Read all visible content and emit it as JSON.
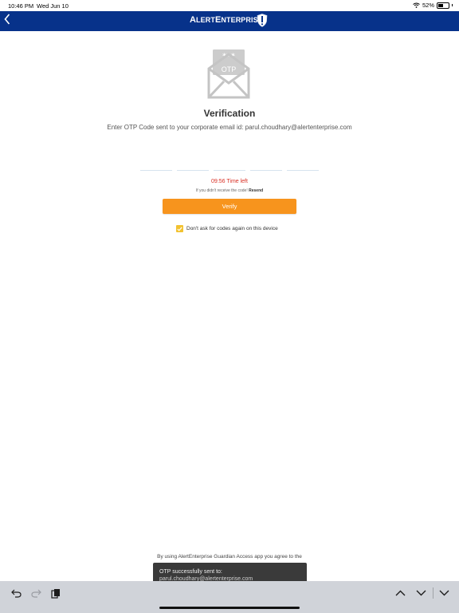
{
  "status_bar": {
    "time": "10:46 PM",
    "date": "Wed Jun 10",
    "battery": "52%"
  },
  "nav": {
    "back_icon": "chevron-left-icon",
    "brand_prefix_big": "A",
    "brand_prefix_small": "LERT",
    "brand_suffix_big": "E",
    "brand_suffix_small": "NTERPRISE",
    "brand_color": "#07328a"
  },
  "illustration": {
    "badge_text": "OTP",
    "badge_stars": "***"
  },
  "title": "Verification",
  "subtitle": "Enter OTP Code sent to your corporate email id: parul.choudhary@alertenterprise.com",
  "timer": "09:56 Time left",
  "resend": {
    "prompt": "If you didn't receive the code!",
    "link": "Resend"
  },
  "verify_button": {
    "label": "Verify",
    "color": "#f7941d"
  },
  "remember": {
    "label": "Don't ask for codes again on this device",
    "checked": true
  },
  "terms": "By using AlertEnterprise Guardian Access app you agree to the",
  "toast": {
    "line1": "OTP successfully sent to:",
    "line2": "parul.choudhary@alertenterprise.com"
  },
  "keyboard_toolbar": {
    "left": [
      "undo-icon",
      "redo-icon",
      "paste-icon"
    ],
    "right": [
      "chevron-up-icon",
      "chevron-down-icon",
      "keyboard-dismiss-icon"
    ]
  }
}
